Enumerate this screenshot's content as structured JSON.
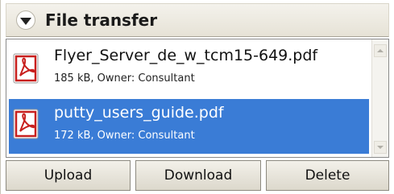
{
  "header": {
    "title": "File transfer",
    "collapse_icon": "chevron-down-icon"
  },
  "files": [
    {
      "name": "Flyer_Server_de_w_tcm15-649.pdf",
      "meta": "185 kB, Owner: Consultant",
      "icon": "pdf-file-icon",
      "selected": false
    },
    {
      "name": "putty_users_guide.pdf",
      "meta": "172 kB, Owner: Consultant",
      "icon": "pdf-file-icon",
      "selected": true
    }
  ],
  "actions": {
    "upload_label": "Upload",
    "download_label": "Download",
    "delete_label": "Delete"
  },
  "colors": {
    "selection": "#3a7cd6",
    "pdf_red": "#c8201e"
  }
}
